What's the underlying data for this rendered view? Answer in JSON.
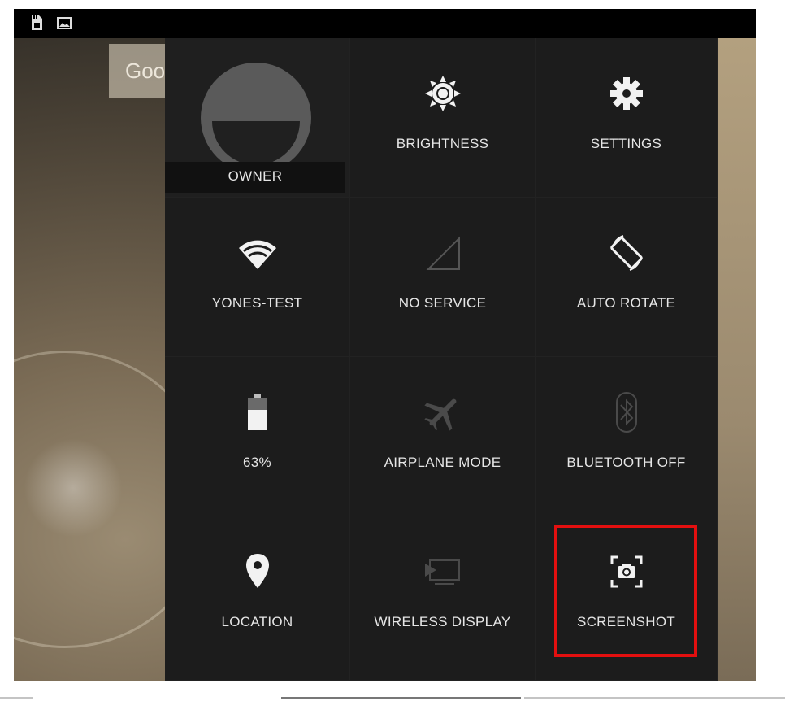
{
  "status_bar": {
    "icons": [
      "sd-card-icon",
      "image-icon"
    ]
  },
  "wallpaper": {
    "search_fragment": "Goo"
  },
  "quick_settings": {
    "tiles": [
      {
        "id": "owner",
        "label": "OWNER",
        "icon": "avatar-icon"
      },
      {
        "id": "brightness",
        "label": "BRIGHTNESS",
        "icon": "brightness-icon"
      },
      {
        "id": "settings",
        "label": "SETTINGS",
        "icon": "gear-icon"
      },
      {
        "id": "wifi",
        "label": "YONES-TEST",
        "icon": "wifi-icon"
      },
      {
        "id": "mobile",
        "label": "NO SERVICE",
        "icon": "signal-icon"
      },
      {
        "id": "rotate",
        "label": "AUTO ROTATE",
        "icon": "rotate-icon"
      },
      {
        "id": "battery",
        "label": "63%",
        "icon": "battery-icon",
        "level": 0.63
      },
      {
        "id": "airplane",
        "label": "AIRPLANE MODE",
        "icon": "airplane-icon"
      },
      {
        "id": "bluetooth",
        "label": "BLUETOOTH OFF",
        "icon": "bluetooth-icon"
      },
      {
        "id": "location",
        "label": "LOCATION",
        "icon": "location-pin-icon"
      },
      {
        "id": "wireless_display",
        "label": "WIRELESS DISPLAY",
        "icon": "cast-icon"
      },
      {
        "id": "screenshot",
        "label": "SCREENSHOT",
        "icon": "screenshot-icon"
      }
    ]
  },
  "highlight": {
    "target": "screenshot",
    "color": "#e30f0f"
  }
}
